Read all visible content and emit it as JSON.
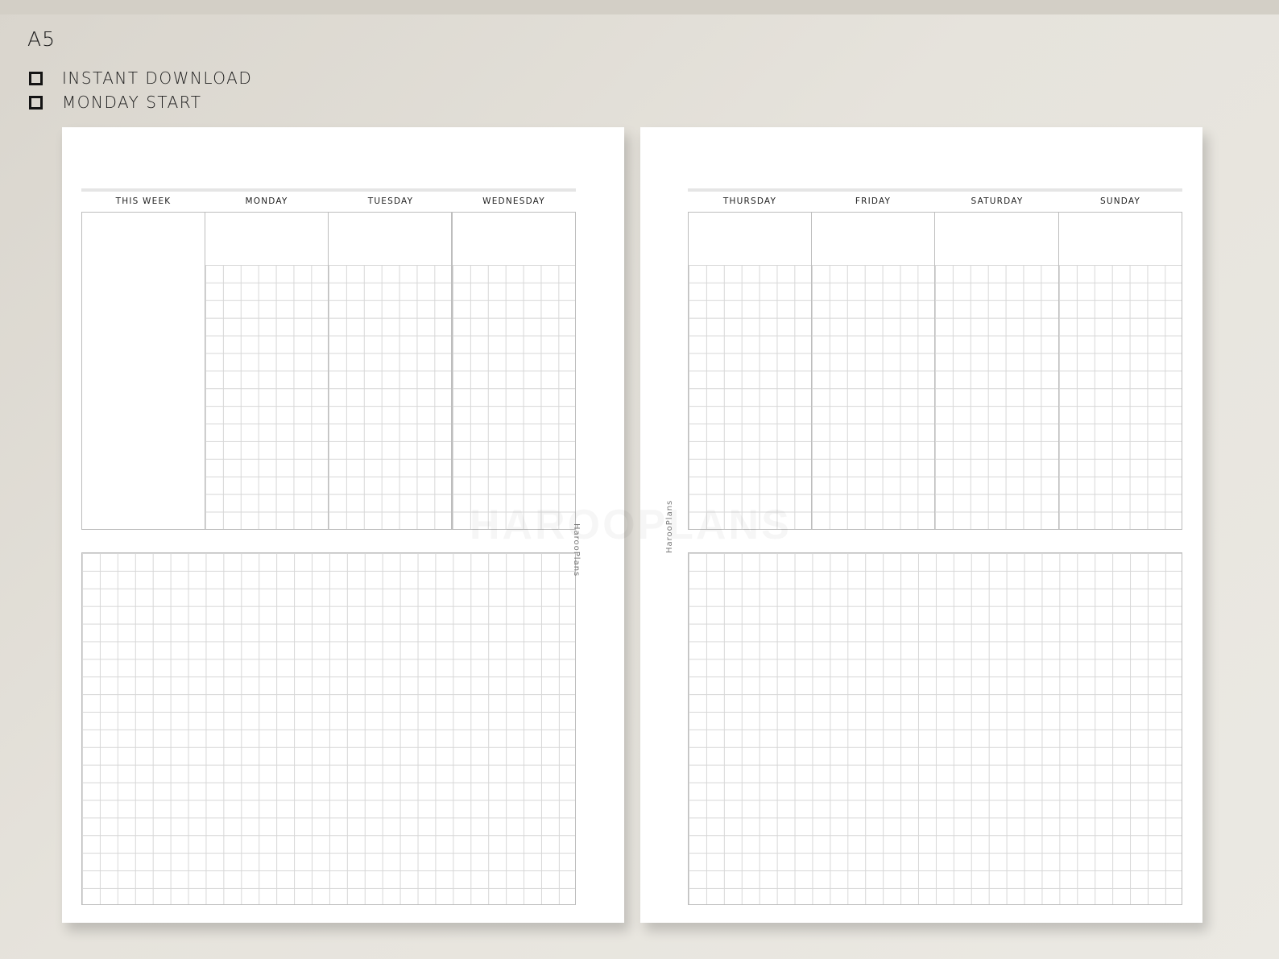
{
  "size_label": "A5",
  "features": [
    "INSTANT DOWNLOAD",
    "MONDAY START"
  ],
  "left_page": {
    "headers": [
      "THIS WEEK",
      "MONDAY",
      "TUESDAY",
      "WEDNESDAY"
    ]
  },
  "right_page": {
    "headers": [
      "THURSDAY",
      "FRIDAY",
      "SATURDAY",
      "SUNDAY"
    ]
  },
  "brand": "HarooPlans",
  "watermark": "HAROOPLANS",
  "icons": {
    "feature_bullet": "checkbox-icon"
  }
}
